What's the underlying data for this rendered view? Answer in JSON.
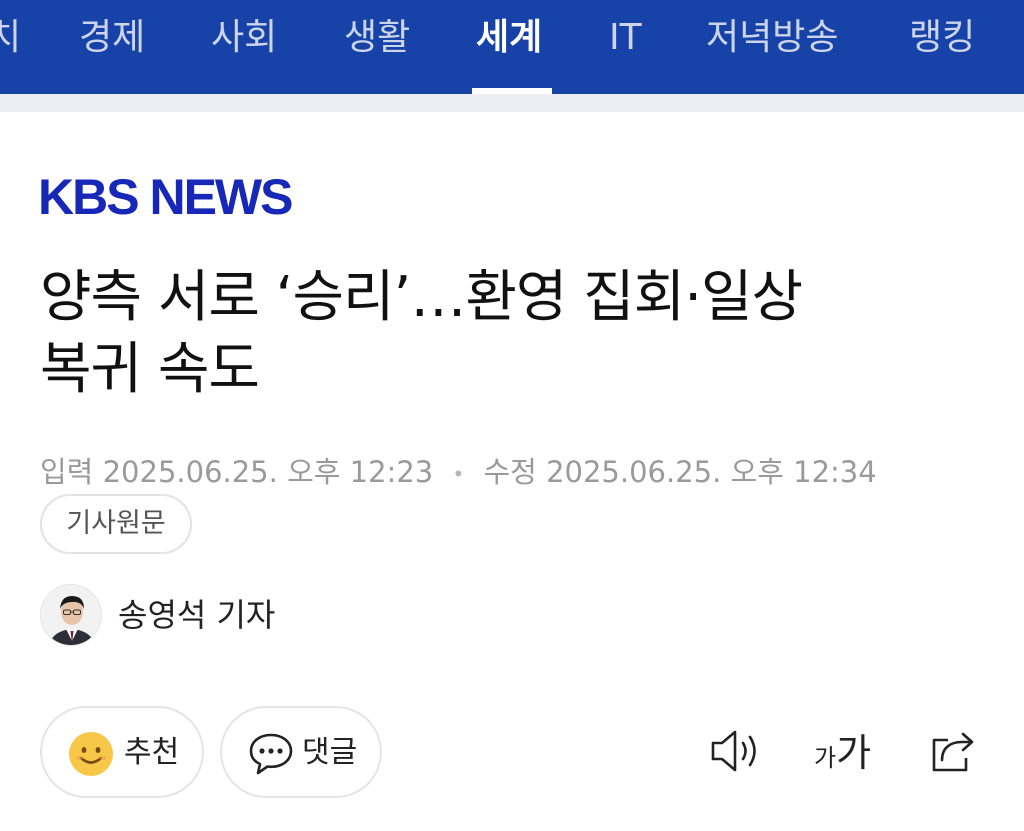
{
  "nav": {
    "items": [
      {
        "label": "치"
      },
      {
        "label": "경제"
      },
      {
        "label": "사회"
      },
      {
        "label": "생활"
      },
      {
        "label": "세계"
      },
      {
        "label": "IT"
      },
      {
        "label": "저녁방송"
      },
      {
        "label": "랭킹"
      }
    ],
    "active_index": 4
  },
  "colors": {
    "nav_bg": "#1743a8",
    "logo": "#1728b8",
    "meta": "#9a9a9a"
  },
  "logo": {
    "text": "KBS NEWS"
  },
  "article": {
    "title_line1": "양측 서로 ‘승리’…환영 집회·일상",
    "title_line2": "복귀 속도",
    "input_label": "입력",
    "input_time": "2025.06.25. 오후 12:23",
    "modified_label": "수정",
    "modified_time": "2025.06.25. 오후 12:34",
    "origin_button": "기사원문"
  },
  "reporter": {
    "name": "송영석 기자"
  },
  "actions": {
    "recommend_label": "추천",
    "comment_label": "댓글",
    "textsize_small": "가",
    "textsize_big": "가"
  },
  "icons": [
    "smile-icon",
    "comment-bubble-icon",
    "speaker-icon",
    "text-size-icon",
    "share-icon"
  ]
}
